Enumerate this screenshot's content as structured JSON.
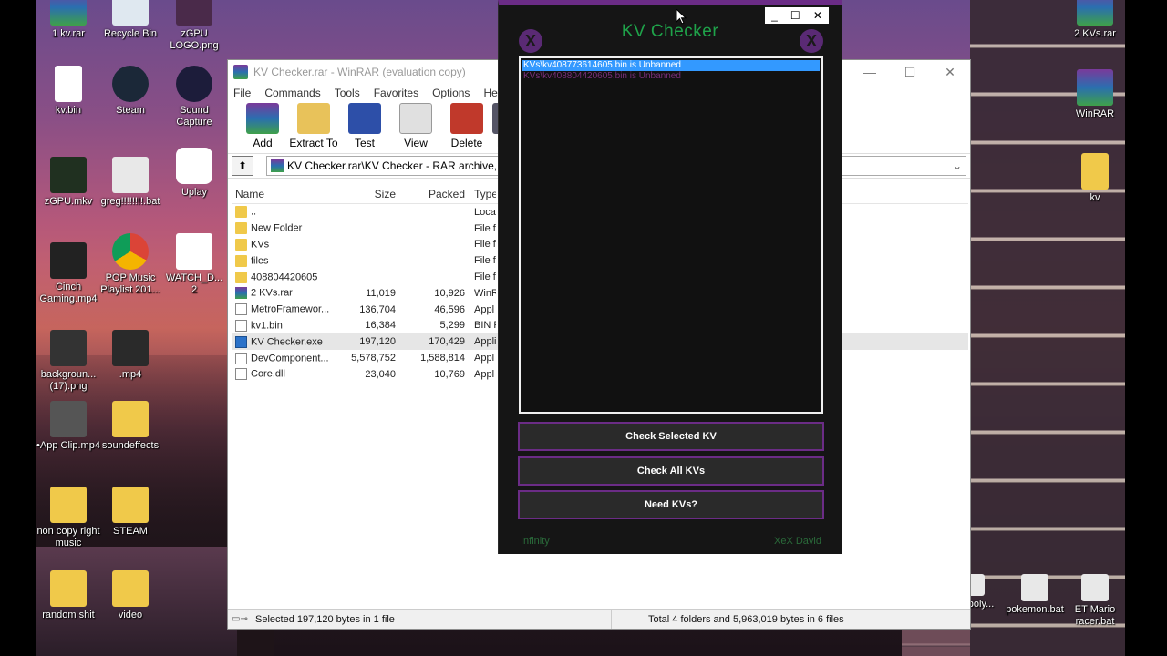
{
  "desktop": {
    "icons": [
      {
        "label": "1 kv.rar",
        "glyph": "rar-icon"
      },
      {
        "label": "Recycle Bin",
        "glyph": "recycle-bin-icon"
      },
      {
        "label": "zGPU LOGO.png",
        "glyph": "image-icon"
      },
      {
        "label": "kv.bin",
        "glyph": "file-icon"
      },
      {
        "label": "Steam",
        "glyph": "steam-icon"
      },
      {
        "label": "Sound Capture",
        "glyph": "sound-capture-icon"
      },
      {
        "label": "zGPU.mkv",
        "glyph": "video-icon"
      },
      {
        "label": "greg!!!!!!!!.bat",
        "glyph": "bat-icon"
      },
      {
        "label": "Uplay",
        "glyph": "uplay-icon"
      },
      {
        "label": "Cinch Gaming.mp4",
        "glyph": "video-icon"
      },
      {
        "label": "POP Music Playlist 201...",
        "glyph": "chrome-icon"
      },
      {
        "label": "WATCH_D... 2",
        "glyph": "watchdogs-icon"
      },
      {
        "label": "backgroun... (17).png",
        "glyph": "image-icon"
      },
      {
        "label": ".mp4",
        "glyph": "video-icon"
      },
      {
        "label": "•App Clip.mp4",
        "glyph": "video-icon"
      },
      {
        "label": "soundeffects",
        "glyph": "folder-icon"
      },
      {
        "label": "non copy right music",
        "glyph": "folder-icon"
      },
      {
        "label": "STEAM",
        "glyph": "folder-icon"
      },
      {
        "label": "random shit",
        "glyph": "folder-icon"
      },
      {
        "label": "video",
        "glyph": "folder-icon"
      },
      {
        "label": "2 KVs.rar",
        "glyph": "rar-icon"
      },
      {
        "label": "WinRAR",
        "glyph": "winrar-icon"
      },
      {
        "label": "kv",
        "glyph": "folder-icon"
      },
      {
        "label": "poly...",
        "glyph": "bat-icon"
      },
      {
        "label": "pokemon.bat",
        "glyph": "bat-icon"
      },
      {
        "label": "ET Mario racer.bat",
        "glyph": "bat-icon"
      }
    ]
  },
  "winrar": {
    "title": "KV Checker.rar - WinRAR (evaluation copy)",
    "menu": [
      "File",
      "Commands",
      "Tools",
      "Favorites",
      "Options",
      "Help"
    ],
    "toolbar": [
      "Add",
      "Extract To",
      "Test",
      "View",
      "Delete",
      "Fi"
    ],
    "address": "KV Checker.rar\\KV Checker - RAR archive, unp",
    "columns": {
      "name": "Name",
      "size": "Size",
      "packed": "Packed",
      "type": "Type"
    },
    "rows": [
      {
        "name": "..",
        "size": "",
        "packed": "",
        "type": "Local",
        "icon": "folder"
      },
      {
        "name": "New Folder",
        "size": "",
        "packed": "",
        "type": "File fo",
        "icon": "folder"
      },
      {
        "name": "KVs",
        "size": "",
        "packed": "",
        "type": "File fo",
        "icon": "folder"
      },
      {
        "name": "files",
        "size": "",
        "packed": "",
        "type": "File fo",
        "icon": "folder"
      },
      {
        "name": "408804420605",
        "size": "",
        "packed": "",
        "type": "File fo",
        "icon": "folder"
      },
      {
        "name": "2 KVs.rar",
        "size": "11,019",
        "packed": "10,926",
        "type": "WinR",
        "icon": "rar"
      },
      {
        "name": "MetroFramewor...",
        "size": "136,704",
        "packed": "46,596",
        "type": "Appl",
        "icon": "file"
      },
      {
        "name": "kv1.bin",
        "size": "16,384",
        "packed": "5,299",
        "type": "BIN F",
        "icon": "file"
      },
      {
        "name": "KV Checker.exe",
        "size": "197,120",
        "packed": "170,429",
        "type": "Appli",
        "icon": "exe",
        "selected": true
      },
      {
        "name": "DevComponent...",
        "size": "5,578,752",
        "packed": "1,588,814",
        "type": "Appl",
        "icon": "file"
      },
      {
        "name": "Core.dll",
        "size": "23,040",
        "packed": "10,769",
        "type": "Appl",
        "icon": "file"
      }
    ],
    "status_left": "Selected 197,120 bytes in 1 file",
    "status_right": "Total 4 folders and 5,963,019 bytes in 6 files"
  },
  "kv_checker": {
    "title": "KV Checker",
    "items": [
      {
        "text": "KVs\\kv408773614605.bin is Unbanned",
        "selected": true
      },
      {
        "text": "KVs\\kv408804420605.bin is Unbanned",
        "selected": false
      }
    ],
    "buttons": {
      "check_selected": "Check Selected KV",
      "check_all": "Check All KVs",
      "need_kvs": "Need KVs?"
    },
    "footer_left": "Infinity",
    "footer_right": "XeX David"
  }
}
